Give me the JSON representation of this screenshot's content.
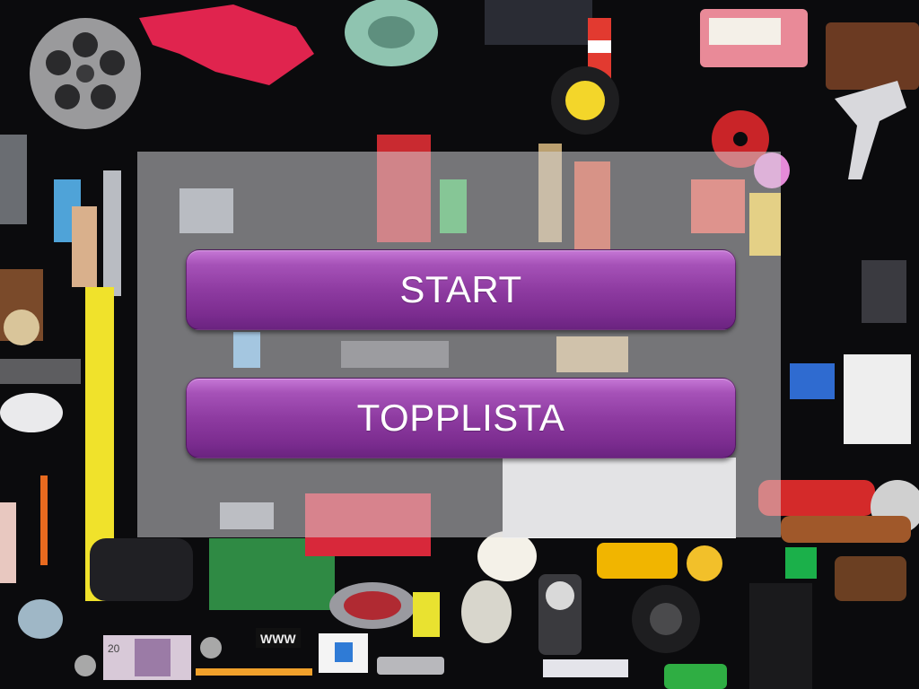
{
  "menu": {
    "start_label": "START",
    "toplist_label": "TOPPLISTA"
  },
  "background": {
    "description_icon": "collage-of-everyday-objects",
    "banknote_text": "20",
    "sign_text": "WWW"
  },
  "colors": {
    "button_top": "#c678d6",
    "button_bottom": "#6a2380",
    "panel": "#d7d7da"
  }
}
